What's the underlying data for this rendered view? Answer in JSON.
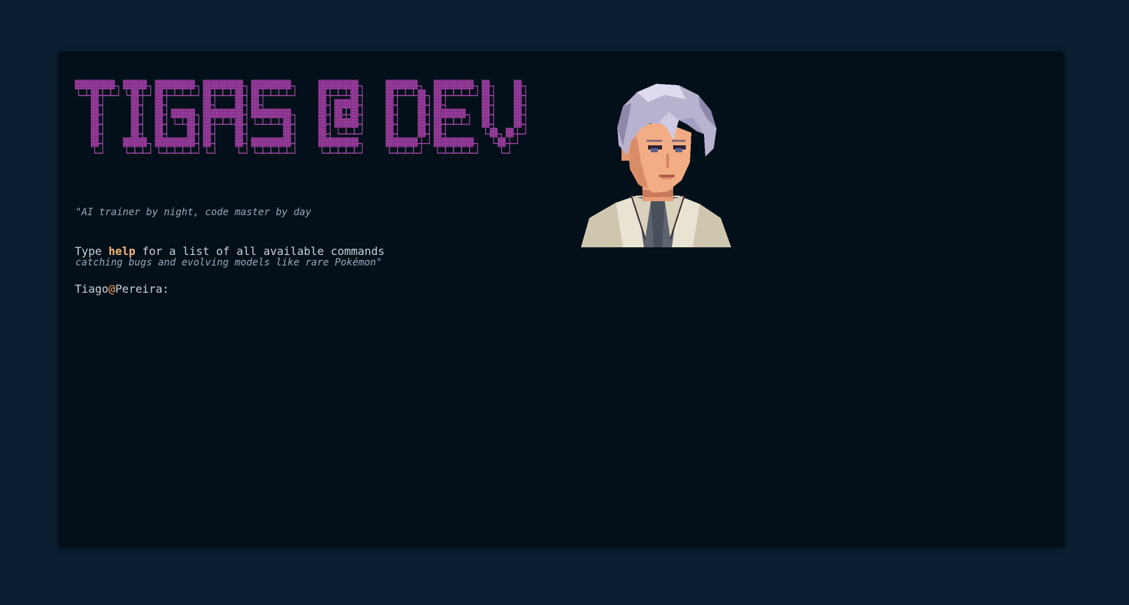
{
  "banner": {
    "text": "TIGAS @ DEV",
    "color": "#9b3ea0",
    "shadow_color": "#b04fb5"
  },
  "motto": {
    "line1": "\"AI trainer by night, code master by day",
    "line2": "catching bugs and evolving models like rare Pokémon\""
  },
  "help": {
    "prefix": "Type ",
    "keyword": "help",
    "suffix": " for a list of all available commands"
  },
  "prompt": {
    "user": "Tiago",
    "at": "@",
    "host": "Pereira",
    "colon": ":",
    "value": ""
  },
  "colors": {
    "page_background": "#0b1f33",
    "terminal_background": "#041019",
    "accent": "#f3b878",
    "banner": "#9b3ea0"
  },
  "icons": {
    "avatar": "pixel-art-portrait"
  }
}
